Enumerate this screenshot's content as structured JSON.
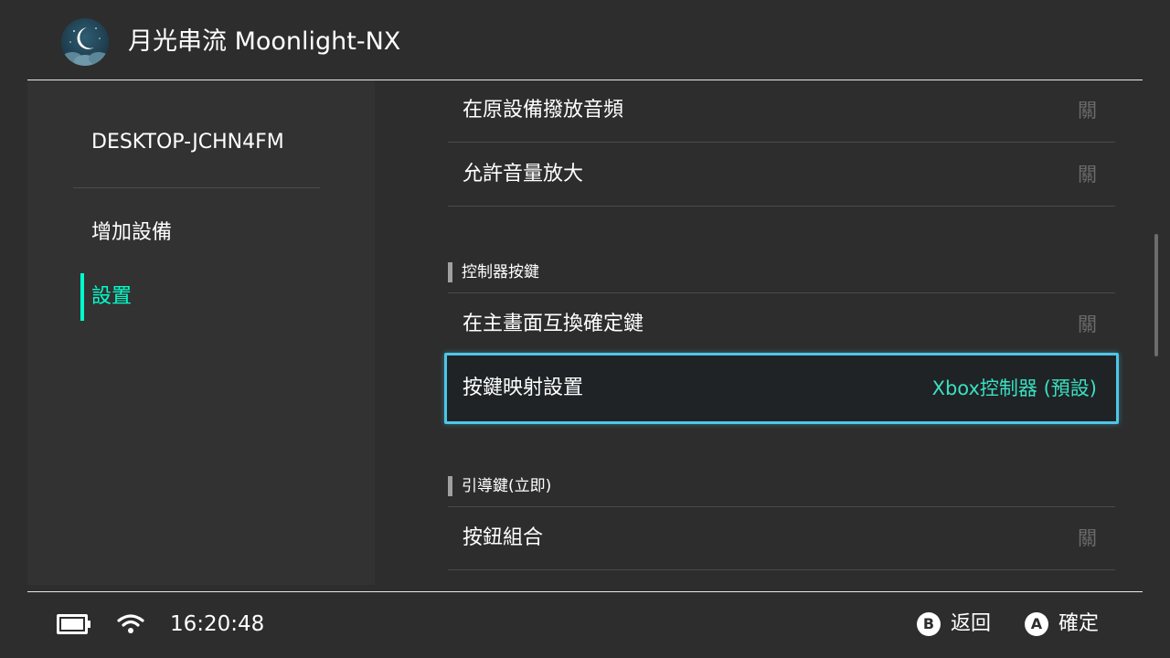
{
  "header": {
    "title": "月光串流 Moonlight-NX",
    "logo_icon": "moon-cloud-logo"
  },
  "sidebar": {
    "host": "DESKTOP-JCHN4FM",
    "items": [
      {
        "label": "增加設備",
        "active": false
      },
      {
        "label": "設置",
        "active": true
      }
    ]
  },
  "settings": {
    "rows_top": [
      {
        "label": "在原設備撥放音頻",
        "value": "關"
      },
      {
        "label": "允許音量放大",
        "value": "關"
      }
    ],
    "section_controller": "控制器按鍵",
    "swap_row": {
      "label": "在主畫面互換確定鍵",
      "value": "關"
    },
    "mapping_row": {
      "label": "按鍵映射設置",
      "value": "Xbox控制器 (預設)"
    },
    "section_guide": "引導鍵(立即)",
    "combo_row": {
      "label": "按鈕組合",
      "value": "關"
    }
  },
  "footer": {
    "time": "16:20:48",
    "back_button": "B",
    "back_label": "返回",
    "confirm_button": "A",
    "confirm_label": "確定"
  },
  "colors": {
    "accent": "#00ffcc",
    "focus_border": "#4ec6e6",
    "value_highlight": "#3be0c0",
    "background": "#2d2d2d"
  }
}
